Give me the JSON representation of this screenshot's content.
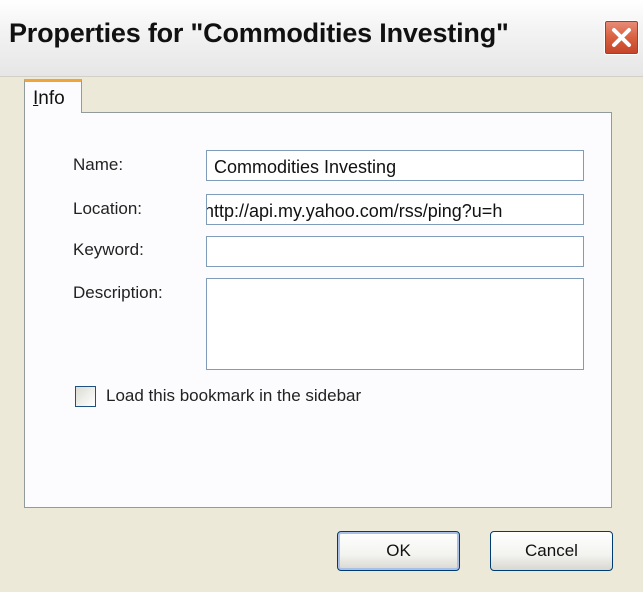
{
  "window": {
    "title": "Properties for \"Commodities Investing\"",
    "close_icon": "close-icon"
  },
  "tabs": [
    {
      "label": "Info",
      "underline": "I",
      "rest": "nfo",
      "selected": true
    }
  ],
  "form": {
    "name": {
      "label": "Name:",
      "value": "Commodities Investing"
    },
    "location": {
      "label": "Location:",
      "value": "nttp://api.my.yahoo.com/rss/ping?u=h"
    },
    "keyword": {
      "label": "Keyword:",
      "value": ""
    },
    "description": {
      "label": "Description:",
      "value": ""
    },
    "sidebar_checkbox": {
      "label": "Load this bookmark in the sidebar",
      "checked": false
    }
  },
  "buttons": {
    "ok": "OK",
    "cancel": "Cancel"
  },
  "colors": {
    "dialog_background": "#ece9d8",
    "tab_accent": "#f0a53a",
    "close_button": "#d8603f",
    "field_border": "#7f9db9"
  }
}
